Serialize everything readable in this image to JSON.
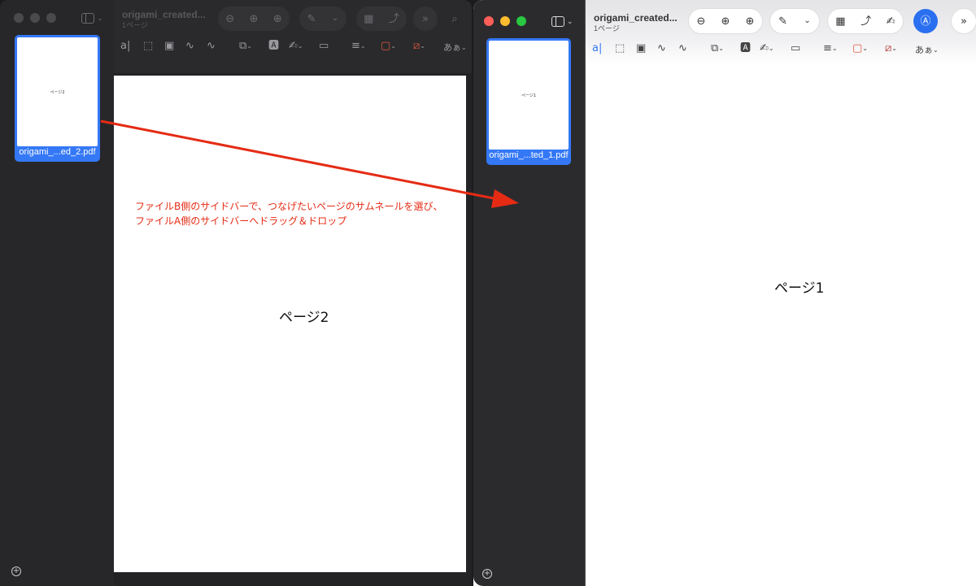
{
  "window_b": {
    "title": "origami_created...",
    "subtitle": "1ページ",
    "thumbnail": {
      "caption": "origami_...ed_2.pdf",
      "page_text": "ページ2"
    },
    "page_label": "ページ2",
    "markup_text": "あぁ"
  },
  "window_a": {
    "title": "origami_created...",
    "subtitle": "1ページ",
    "thumbnail": {
      "caption": "origami_...ted_1.pdf",
      "page_text": "ページ1"
    },
    "page_label": "ページ1",
    "markup_text": "あぁ"
  },
  "annotation": {
    "line1": "ファイルB側のサイドバーで、つなげたいページのサムネールを選び、",
    "line2": "ファイルA側のサイドバーへドラッグ＆ドロップ",
    "color": "#e52b14"
  },
  "icons": [
    "sidebar-toggle-icon",
    "zoom-out-icon",
    "zoom-in-icon",
    "zoom-fit-icon",
    "pen-icon",
    "chevron-down-icon",
    "image-icon",
    "rotate-icon",
    "signature-icon",
    "markup-icon",
    "more-icon",
    "search-icon",
    "add-page-icon"
  ],
  "colors": {
    "accent": "#3478f6",
    "arrow": "#e52b14"
  }
}
